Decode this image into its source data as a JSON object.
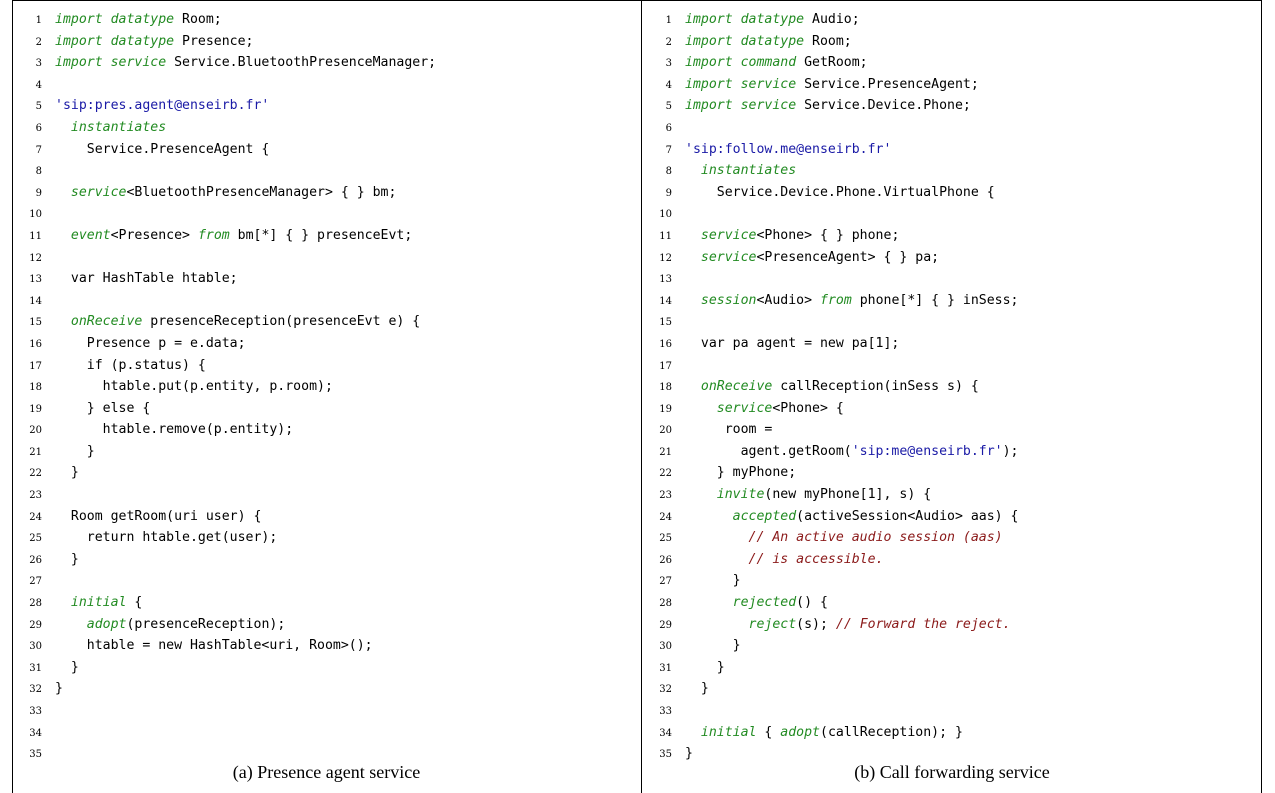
{
  "left_panel": {
    "caption": "(a) Presence agent service",
    "lines": [
      [
        [
          "k",
          "import datatype"
        ],
        [
          "t",
          " Room;"
        ]
      ],
      [
        [
          "k",
          "import datatype"
        ],
        [
          "t",
          " Presence;"
        ]
      ],
      [
        [
          "k",
          "import service"
        ],
        [
          "t",
          " Service.BluetoothPresenceManager;"
        ]
      ],
      [],
      [
        [
          "s",
          "'sip:pres.agent@enseirb.fr'"
        ]
      ],
      [
        [
          "t",
          "  "
        ],
        [
          "k",
          "instantiates"
        ]
      ],
      [
        [
          "t",
          "    Service.PresenceAgent {"
        ]
      ],
      [],
      [
        [
          "t",
          "  "
        ],
        [
          "k",
          "service"
        ],
        [
          "t",
          "<BluetoothPresenceManager> { } bm;"
        ]
      ],
      [],
      [
        [
          "t",
          "  "
        ],
        [
          "k",
          "event"
        ],
        [
          "t",
          "<Presence> "
        ],
        [
          "k",
          "from"
        ],
        [
          "t",
          " bm[*] { } presenceEvt;"
        ]
      ],
      [],
      [
        [
          "t",
          "  var HashTable htable;"
        ]
      ],
      [],
      [
        [
          "t",
          "  "
        ],
        [
          "k",
          "onReceive"
        ],
        [
          "t",
          " presenceReception(presenceEvt e) {"
        ]
      ],
      [
        [
          "t",
          "    Presence p = e.data;"
        ]
      ],
      [
        [
          "t",
          "    if (p.status) {"
        ]
      ],
      [
        [
          "t",
          "      htable.put(p.entity, p.room);"
        ]
      ],
      [
        [
          "t",
          "    } else {"
        ]
      ],
      [
        [
          "t",
          "      htable.remove(p.entity);"
        ]
      ],
      [
        [
          "t",
          "    }"
        ]
      ],
      [
        [
          "t",
          "  }"
        ]
      ],
      [],
      [
        [
          "t",
          "  Room getRoom(uri user) {"
        ]
      ],
      [
        [
          "t",
          "    return htable.get(user);"
        ]
      ],
      [
        [
          "t",
          "  }"
        ]
      ],
      [],
      [
        [
          "t",
          "  "
        ],
        [
          "k",
          "initial"
        ],
        [
          "t",
          " {"
        ]
      ],
      [
        [
          "t",
          "    "
        ],
        [
          "k",
          "adopt"
        ],
        [
          "t",
          "(presenceReception);"
        ]
      ],
      [
        [
          "t",
          "    htable = new HashTable<uri, Room>();"
        ]
      ],
      [
        [
          "t",
          "  }"
        ]
      ],
      [
        [
          "t",
          "}"
        ]
      ],
      [],
      [],
      []
    ]
  },
  "right_panel": {
    "caption": "(b) Call forwarding service",
    "lines": [
      [
        [
          "k",
          "import datatype"
        ],
        [
          "t",
          " Audio;"
        ]
      ],
      [
        [
          "k",
          "import datatype"
        ],
        [
          "t",
          " Room;"
        ]
      ],
      [
        [
          "k",
          "import command"
        ],
        [
          "t",
          " GetRoom;"
        ]
      ],
      [
        [
          "k",
          "import service"
        ],
        [
          "t",
          " Service.PresenceAgent;"
        ]
      ],
      [
        [
          "k",
          "import service"
        ],
        [
          "t",
          " Service.Device.Phone;"
        ]
      ],
      [],
      [
        [
          "s",
          "'sip:follow.me@enseirb.fr'"
        ]
      ],
      [
        [
          "t",
          "  "
        ],
        [
          "k",
          "instantiates"
        ]
      ],
      [
        [
          "t",
          "    Service.Device.Phone.VirtualPhone {"
        ]
      ],
      [],
      [
        [
          "t",
          "  "
        ],
        [
          "k",
          "service"
        ],
        [
          "t",
          "<Phone> { } phone;"
        ]
      ],
      [
        [
          "t",
          "  "
        ],
        [
          "k",
          "service"
        ],
        [
          "t",
          "<PresenceAgent> { } pa;"
        ]
      ],
      [],
      [
        [
          "t",
          "  "
        ],
        [
          "k",
          "session"
        ],
        [
          "t",
          "<Audio> "
        ],
        [
          "k",
          "from"
        ],
        [
          "t",
          " phone[*] { } inSess;"
        ]
      ],
      [],
      [
        [
          "t",
          "  var pa agent = new pa[1];"
        ]
      ],
      [],
      [
        [
          "t",
          "  "
        ],
        [
          "k",
          "onReceive"
        ],
        [
          "t",
          " callReception(inSess s) {"
        ]
      ],
      [
        [
          "t",
          "    "
        ],
        [
          "k",
          "service"
        ],
        [
          "t",
          "<Phone> {"
        ]
      ],
      [
        [
          "t",
          "     room ="
        ]
      ],
      [
        [
          "t",
          "       agent.getRoom("
        ],
        [
          "s",
          "'sip:me@enseirb.fr'"
        ],
        [
          "t",
          ");"
        ]
      ],
      [
        [
          "t",
          "    } myPhone;"
        ]
      ],
      [
        [
          "t",
          "    "
        ],
        [
          "k",
          "invite"
        ],
        [
          "t",
          "(new myPhone[1], s) {"
        ]
      ],
      [
        [
          "t",
          "      "
        ],
        [
          "k",
          "accepted"
        ],
        [
          "t",
          "(activeSession<Audio> aas) {"
        ]
      ],
      [
        [
          "t",
          "        "
        ],
        [
          "c",
          "// An active audio session (aas)"
        ]
      ],
      [
        [
          "t",
          "        "
        ],
        [
          "c",
          "// is accessible."
        ]
      ],
      [
        [
          "t",
          "      }"
        ]
      ],
      [
        [
          "t",
          "      "
        ],
        [
          "k",
          "rejected"
        ],
        [
          "t",
          "() {"
        ]
      ],
      [
        [
          "t",
          "        "
        ],
        [
          "k",
          "reject"
        ],
        [
          "t",
          "(s); "
        ],
        [
          "c",
          "// Forward the reject."
        ]
      ],
      [
        [
          "t",
          "      }"
        ]
      ],
      [
        [
          "t",
          "    }"
        ]
      ],
      [
        [
          "t",
          "  }"
        ]
      ],
      [],
      [
        [
          "t",
          "  "
        ],
        [
          "k",
          "initial"
        ],
        [
          "t",
          " { "
        ],
        [
          "k",
          "adopt"
        ],
        [
          "t",
          "(callReception); }"
        ]
      ],
      [
        [
          "t",
          "}"
        ]
      ]
    ]
  }
}
